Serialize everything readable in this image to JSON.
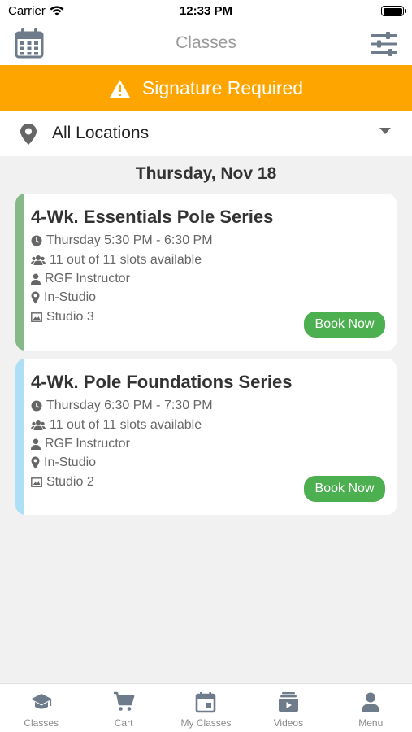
{
  "status_bar": {
    "carrier": "Carrier",
    "time": "12:33 PM"
  },
  "header": {
    "title": "Classes",
    "left_icon": "calendar-icon",
    "right_icon": "filter-sliders-icon"
  },
  "signature_banner": {
    "text": "Signature Required",
    "icon": "warning-icon",
    "color": "#ffa500"
  },
  "location": {
    "label": "All Locations",
    "icon": "map-pin-icon"
  },
  "date_header": "Thursday, Nov 18",
  "classes": [
    {
      "title": "4-Wk. Essentials Pole Series",
      "time": "Thursday 5:30 PM - 6:30 PM",
      "slots": "11 out of 11 slots available",
      "instructor": "RGF Instructor",
      "mode": "In-Studio",
      "room": "Studio 3",
      "book_label": "Book Now",
      "stripe_color": "#86b889"
    },
    {
      "title": "4-Wk. Pole Foundations Series",
      "time": "Thursday 6:30 PM - 7:30 PM",
      "slots": "11 out of 11 slots available",
      "instructor": "RGF Instructor",
      "mode": "In-Studio",
      "room": "Studio 2",
      "book_label": "Book Now",
      "stripe_color": "#aee0f5"
    }
  ],
  "tabs": [
    {
      "label": "Classes",
      "icon": "graduation-cap-icon"
    },
    {
      "label": "Cart",
      "icon": "cart-icon"
    },
    {
      "label": "My Classes",
      "icon": "calendar-day-icon"
    },
    {
      "label": "Videos",
      "icon": "video-library-icon"
    },
    {
      "label": "Menu",
      "icon": "user-icon"
    }
  ],
  "colors": {
    "accent_green": "#4caf50",
    "banner_orange": "#ffa500",
    "tab_icon": "#6d7b8a"
  }
}
